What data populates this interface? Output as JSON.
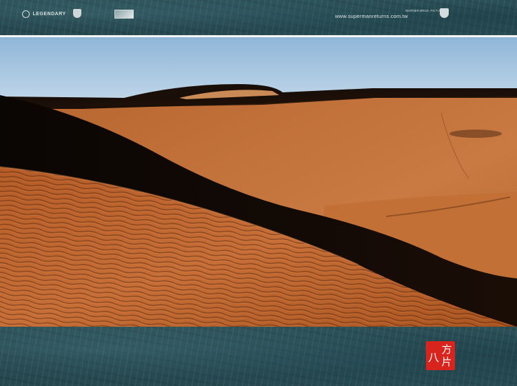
{
  "header": {
    "studio_logo_text": "LEGENDARY",
    "site_url": "www.supermanreturns.com.tw",
    "credit_text": "WARNER BROS. PICTURES",
    "logos": [
      "legendary-logo",
      "warner-bros-shield-icon",
      "dc-box-logo",
      "warner-bros-shield-icon"
    ]
  },
  "photo": {
    "subject": "desert-sand-dunes",
    "colors": {
      "sky_top": "#8fb6d8",
      "sky_bottom": "#d9e6f0",
      "sand_light": "#c4703a",
      "sand_dark": "#8a4820",
      "shadow": "#0d0805"
    }
  },
  "footer": {
    "seal_color": "#d8241c",
    "seal_chars": [
      "方",
      "片",
      "八"
    ]
  }
}
